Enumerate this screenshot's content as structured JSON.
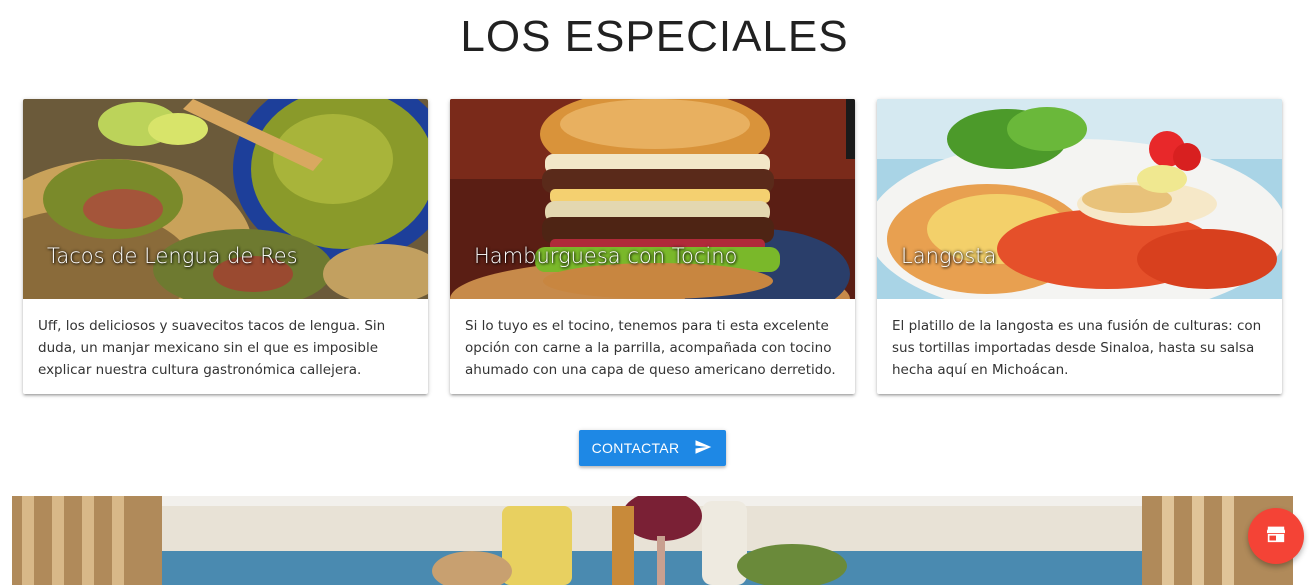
{
  "section": {
    "title": "LOS ESPECIALES"
  },
  "cards": [
    {
      "title": "Tacos de Lengua de Res",
      "text": "Uff, los deliciosos y suavecitos tacos de lengua. Sin duda, un manjar mexicano sin el que es imposible explicar nuestra cultura gastronómica callejera."
    },
    {
      "title": "Hamburguesa con Tocino",
      "text": "Si lo tuyo es el tocino, tenemos para ti esta excelente opción con carne a la parrilla, acompañada con tocino ahumado con una capa de queso americano derretido."
    },
    {
      "title": "Langosta",
      "text": "El platillo de la langosta es una fusión de culturas: con sus tortillas importadas desde Sinaloa, hasta su salsa hecha aquí en Michoácan."
    }
  ],
  "contact_button": {
    "label": "CONTACTAR",
    "icon": "send-icon"
  },
  "fab": {
    "icon": "store-icon"
  },
  "colors": {
    "primary": "#1e88e5",
    "fab": "#f44336"
  }
}
